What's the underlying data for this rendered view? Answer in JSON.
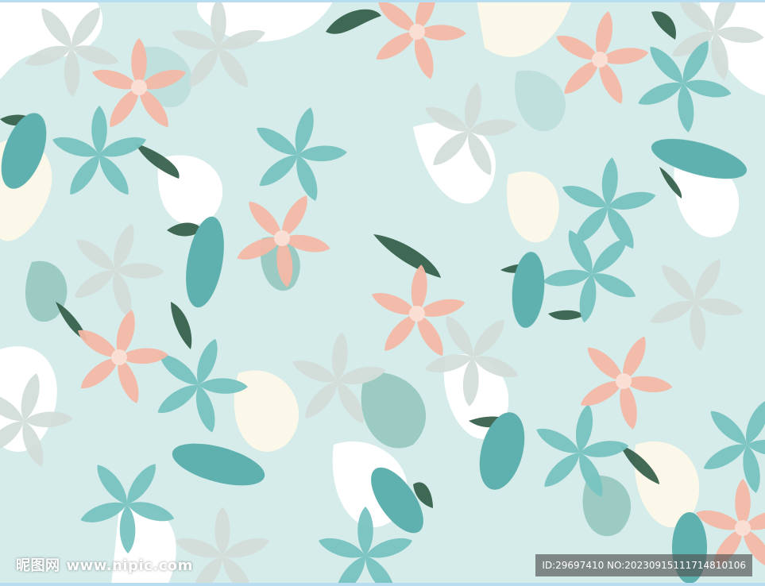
{
  "image": {
    "colors": {
      "background": "#d6ecea",
      "camo_light": "#bfe0dc",
      "camo_mid": "#9ccbc3",
      "camo_cream": "#fbf8e9",
      "white": "#ffffff",
      "teal_flower": "#79c3c1",
      "teal_dark": "#4e9f9c",
      "pink_flower": "#f4b9a7",
      "pink_light": "#fbe2d8",
      "grey_flower": "#d3dedb",
      "leaf_dark": "#2f5a45"
    }
  },
  "watermark": {
    "site_name": "昵图网",
    "site_url": "www.nipic.com",
    "id_text": "ID:29697410 NO:20230915111714810106"
  }
}
